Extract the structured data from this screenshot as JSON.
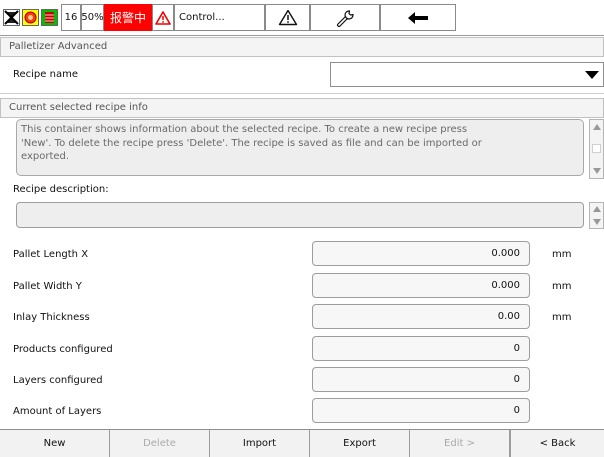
{
  "status_bar": {
    "value_16": "16",
    "value_50": "50%",
    "alarm_text": "报警中",
    "control_label": "Control...",
    "colors": {
      "alarm_bg": "#ff0000",
      "yellow": "#ffff00",
      "green": "#00c000",
      "red": "#ff0000"
    },
    "icons": [
      "disabled-hourglass-icon",
      "circle-stop-icon",
      "battery-icon",
      "warning-icon",
      "warning-icon",
      "wrench-icon",
      "arrow-left-icon"
    ]
  },
  "page": {
    "title": "Palletizer Advanced"
  },
  "recipe": {
    "label": "Recipe name",
    "value": ""
  },
  "info": {
    "title": "Current selected recipe info",
    "lines": [
      "This container shows information about the selected recipe. To create a new recipe press",
      "'New'. To delete the recipe press 'Delete'. The recipe is saved as file and can be imported or",
      "exported."
    ]
  },
  "description": {
    "label": "Recipe description:",
    "value": ""
  },
  "fields": [
    {
      "label": "Pallet Length X",
      "value": "0.000",
      "unit": "mm"
    },
    {
      "label": "Pallet Width Y",
      "value": "0.000",
      "unit": "mm"
    },
    {
      "label": "Inlay Thickness",
      "value": "0.00",
      "unit": "mm"
    },
    {
      "label": "Products configured",
      "value": "0",
      "unit": ""
    },
    {
      "label": "Layers configured",
      "value": "0",
      "unit": ""
    },
    {
      "label": "Amount of Layers",
      "value": "0",
      "unit": ""
    }
  ],
  "buttons": {
    "new": "New",
    "delete": "Delete",
    "import": "Import",
    "export": "Export",
    "edit": "Edit >",
    "back": "< Back"
  }
}
